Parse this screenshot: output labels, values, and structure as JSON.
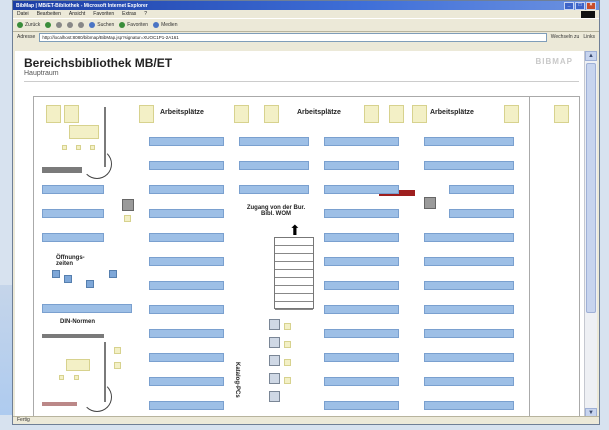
{
  "window": {
    "title": "BibMap | MB/ET-Bibliothek - Microsoft Internet Explorer",
    "buttons": {
      "minimize": "_",
      "maximize": "□",
      "close": "×"
    }
  },
  "menu": [
    "Datei",
    "Bearbeiten",
    "Ansicht",
    "Favoriten",
    "Extras",
    "?"
  ],
  "toolbar": {
    "back": "Zurück",
    "forward": "→",
    "stop": "×",
    "refresh": "↻",
    "home": "⌂",
    "search": "Suchen",
    "favorites": "Favoriten",
    "media": "Medien"
  },
  "address": {
    "label": "Adresse",
    "url": "http://localhost:8080/bibmap/BibMap.jsp?signatur=XUOC1P1-2A161",
    "go": "Wechseln zu",
    "links": "Links"
  },
  "page": {
    "title": "Bereichsbibliothek MB/ET",
    "subtitle": "Hauptraum",
    "logo": "BIBMAP"
  },
  "map": {
    "workspace_label": "Arbeitsplätze",
    "entrance_label": "Zugang von der Bur. Bibl. WOM",
    "opening_label": "Öffnungs-zeiten",
    "scanner_label": "DIN-Normen",
    "catalog_label": "Katalog-PCs"
  },
  "status": "Fertig"
}
